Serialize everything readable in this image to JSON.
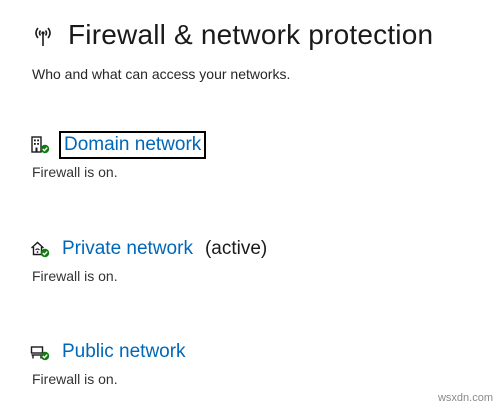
{
  "header": {
    "title": "Firewall & network protection",
    "subtitle": "Who and what can access your networks.",
    "icon": "antenna-broadcast-icon"
  },
  "networks": [
    {
      "name": "Domain network",
      "active_label": "",
      "status": "Firewall is on.",
      "icon": "domain-building-icon",
      "focused": true
    },
    {
      "name": "Private network",
      "active_label": "(active)",
      "status": "Firewall is on.",
      "icon": "home-network-icon",
      "focused": false
    },
    {
      "name": "Public network",
      "active_label": "",
      "status": "Firewall is on.",
      "icon": "public-network-bench-icon",
      "focused": false
    }
  ],
  "watermark": "wsxdn.com",
  "colors": {
    "link": "#0067b8",
    "check": "#107c10",
    "text": "#1a1a1a"
  }
}
